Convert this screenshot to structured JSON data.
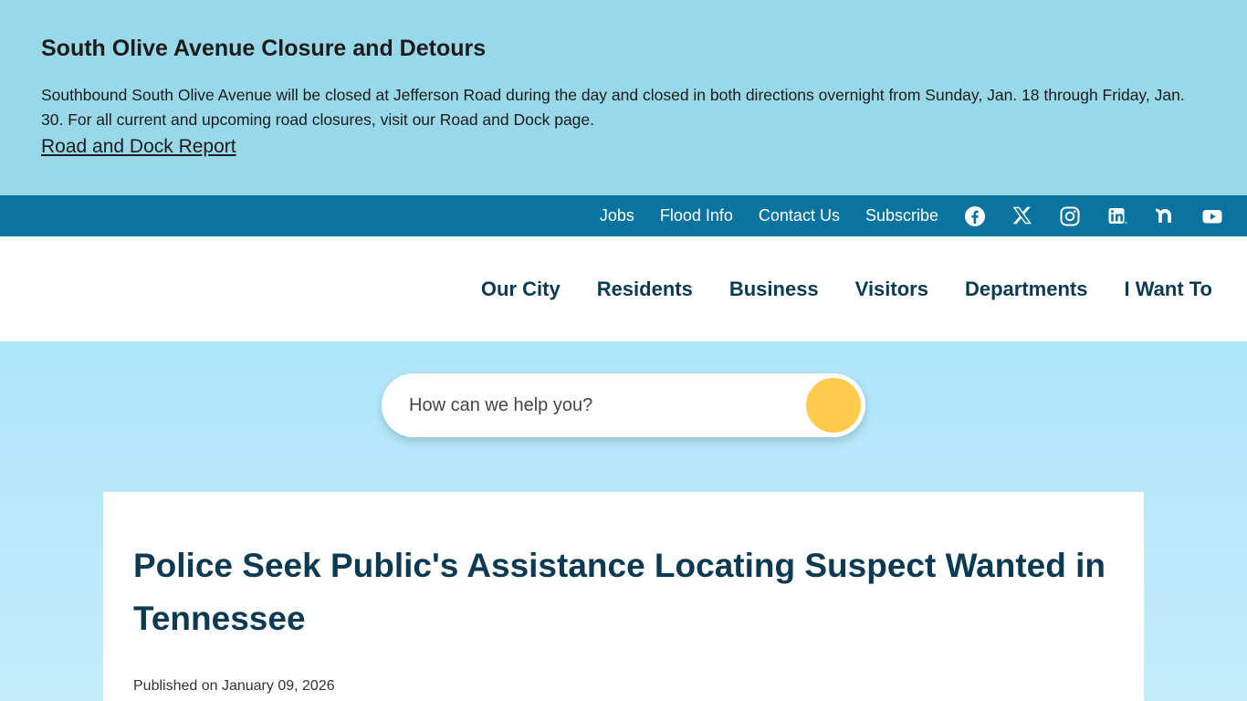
{
  "alert": {
    "title": "South Olive Avenue Closure and Detours",
    "body": "Southbound South Olive Avenue will be closed at Jefferson Road during the day and closed in both directions overnight from Sunday, Jan. 18 through Friday, Jan. 30. For all current and upcoming road closures, visit our Road and Dock page.",
    "link": "Road and Dock Report",
    "background_color": "#98d8e9"
  },
  "utility_nav": {
    "links": [
      "Jobs",
      "Flood Info",
      "Contact Us",
      "Subscribe"
    ],
    "social_icons": [
      "facebook-icon",
      "x-icon",
      "instagram-icon",
      "linkedin-icon",
      "nextdoor-icon",
      "youtube-icon"
    ],
    "background_color": "#0a73a0"
  },
  "main_nav": {
    "items": [
      "Our City",
      "Residents",
      "Business",
      "Visitors",
      "Departments",
      "I Want To"
    ],
    "text_color": "#0b3a52"
  },
  "search": {
    "placeholder": "How can we help you?",
    "button_color": "#fecb4c"
  },
  "article": {
    "title": "Police Seek Public's Assistance Locating Suspect Wanted in Tennessee",
    "published": "Published on January 09, 2026"
  }
}
